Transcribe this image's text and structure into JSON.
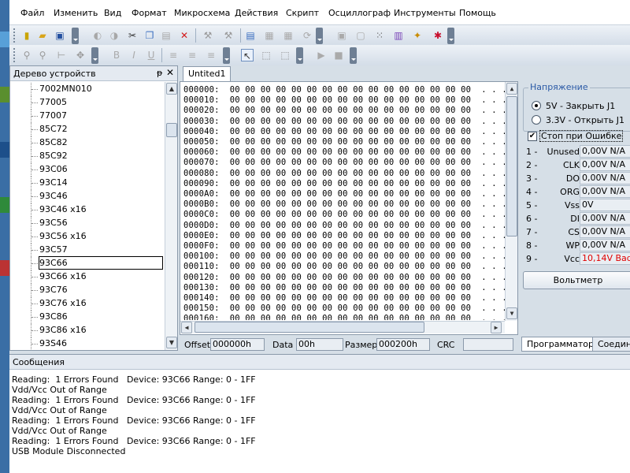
{
  "menu": [
    "Файл",
    "Изменить",
    "Вид",
    "Формат",
    "Микросхема",
    "Действия",
    "Скрипт",
    "Осциллограф",
    "Инструменты",
    "Помощь"
  ],
  "tree": {
    "title": "Дерево устройств",
    "pin_glyph": "ᵽ",
    "close_glyph": "✕",
    "items": [
      "7002MN010",
      "77005",
      "77007",
      "85C72",
      "85C82",
      "85C92",
      "93C06",
      "93C14",
      "93C46",
      "93C46 x16",
      "93C56",
      "93C56 x16",
      "93C57",
      "93C66",
      "93C66 x16",
      "93C76",
      "93C76 x16",
      "93C86",
      "93C86 x16",
      "93S46"
    ],
    "selected": "93C66"
  },
  "editor": {
    "tab": "Untited1",
    "rows": [
      "000000:  00 00 00 00 00 00 00 00 00 00 00 00 00 00 00 00  . . . . . . . . . . . . . . . .",
      "000010:  00 00 00 00 00 00 00 00 00 00 00 00 00 00 00 00  . . . . . . . . . . . . . . . .",
      "000020:  00 00 00 00 00 00 00 00 00 00 00 00 00 00 00 00  . . . . . . . . . . . . . . . .",
      "000030:  00 00 00 00 00 00 00 00 00 00 00 00 00 00 00 00  . . . . . . . . . . . . . . . .",
      "000040:  00 00 00 00 00 00 00 00 00 00 00 00 00 00 00 00  . . . . . . . . . . . . . . . .",
      "000050:  00 00 00 00 00 00 00 00 00 00 00 00 00 00 00 00  . . . . . . . . . . . . . . . .",
      "000060:  00 00 00 00 00 00 00 00 00 00 00 00 00 00 00 00  . . . . . . . . . . . . . . . .",
      "000070:  00 00 00 00 00 00 00 00 00 00 00 00 00 00 00 00  . . . . . . . . . . . . . . . .",
      "000080:  00 00 00 00 00 00 00 00 00 00 00 00 00 00 00 00  . . . . . . . . . . . . . . . .",
      "000090:  00 00 00 00 00 00 00 00 00 00 00 00 00 00 00 00  . . . . . . . . . . . . . . . .",
      "0000A0:  00 00 00 00 00 00 00 00 00 00 00 00 00 00 00 00  . . . . . . . . . . . . . . . .",
      "0000B0:  00 00 00 00 00 00 00 00 00 00 00 00 00 00 00 00  . . . . . . . . . . . . . . . .",
      "0000C0:  00 00 00 00 00 00 00 00 00 00 00 00 00 00 00 00  . . . . . . . . . . . . . . . .",
      "0000D0:  00 00 00 00 00 00 00 00 00 00 00 00 00 00 00 00  . . . . . . . . . . . . . . . .",
      "0000E0:  00 00 00 00 00 00 00 00 00 00 00 00 00 00 00 00  . . . . . . . . . . . . . . . .",
      "0000F0:  00 00 00 00 00 00 00 00 00 00 00 00 00 00 00 00  . . . . . . . . . . . . . . . .",
      "000100:  00 00 00 00 00 00 00 00 00 00 00 00 00 00 00 00  . . . . . . . . . . . . . . . .",
      "000110:  00 00 00 00 00 00 00 00 00 00 00 00 00 00 00 00  . . . . . . . . . . . . . . . .",
      "000120:  00 00 00 00 00 00 00 00 00 00 00 00 00 00 00 00  . . . . . . . . . . . . . . . .",
      "000130:  00 00 00 00 00 00 00 00 00 00 00 00 00 00 00 00  . . . . . . . . . . . . . . . .",
      "000140:  00 00 00 00 00 00 00 00 00 00 00 00 00 00 00 00  . . . . . . . . . . . . . . . .",
      "000150:  00 00 00 00 00 00 00 00 00 00 00 00 00 00 00 00  . . . . . . . . . . . . . . . .",
      "000160:  00 00 00 00 00 00 00 00 00 00 00 00 00 00 00 00  . . . . . . . . . . . . . . . ."
    ]
  },
  "status": {
    "offset_label": "Offset",
    "offset_value": "000000h",
    "data_label": "Data",
    "data_value": "00h",
    "size_label": "Размер",
    "size_value": "000200h",
    "crc_label": "CRC",
    "crc_value": ""
  },
  "voltage": {
    "legend": "Напряжение",
    "opt1": "5V - Закрыть J1",
    "opt2": "3.3V - Открыть J1",
    "stop_on_error": "Стоп при Ошибке",
    "check_glyph": "✔"
  },
  "pins": [
    {
      "n": "1 -",
      "name": "Unused",
      "value": "0,00V  N/A",
      "color": "#000000"
    },
    {
      "n": "2 -",
      "name": "CLK",
      "value": "0,00V  N/A",
      "color": "#000000"
    },
    {
      "n": "3 -",
      "name": "DO",
      "value": "0,00V  N/A",
      "color": "#000000"
    },
    {
      "n": "4 -",
      "name": "ORG",
      "value": "0,00V  N/A",
      "color": "#000000"
    },
    {
      "n": "5 -",
      "name": "Vss",
      "value": "0V",
      "color": "#000000"
    },
    {
      "n": "6 -",
      "name": "DI",
      "value": "0,00V  N/A",
      "color": "#000000"
    },
    {
      "n": "7 -",
      "name": "CS",
      "value": "0,00V  N/A",
      "color": "#000000"
    },
    {
      "n": "8 -",
      "name": "WP",
      "value": "0,00V  N/A",
      "color": "#000000"
    },
    {
      "n": "9 -",
      "name": "Vcc",
      "value": "10,14V  Bad",
      "color": "#e00000"
    }
  ],
  "voltmeter_button": "Вольтметр",
  "right_tabs": [
    "Программатор",
    "Соедине"
  ],
  "messages": {
    "title": "Сообщения",
    "lines": [
      "Reading:  1 Errors Found   Device: 93C66 Range: 0 - 1FF",
      "Vdd/Vcc Out of Range",
      "Reading:  1 Errors Found   Device: 93C66 Range: 0 - 1FF",
      "Vdd/Vcc Out of Range",
      "Reading:  1 Errors Found   Device: 93C66 Range: 0 - 1FF",
      "Vdd/Vcc Out of Range",
      "Reading:  1 Errors Found   Device: 93C66 Range: 0 - 1FF",
      "USB Module Disconnected"
    ]
  },
  "colors": {
    "accent": "#2b5aa6",
    "error": "#e00000",
    "chrome": "#d6dfe7"
  }
}
